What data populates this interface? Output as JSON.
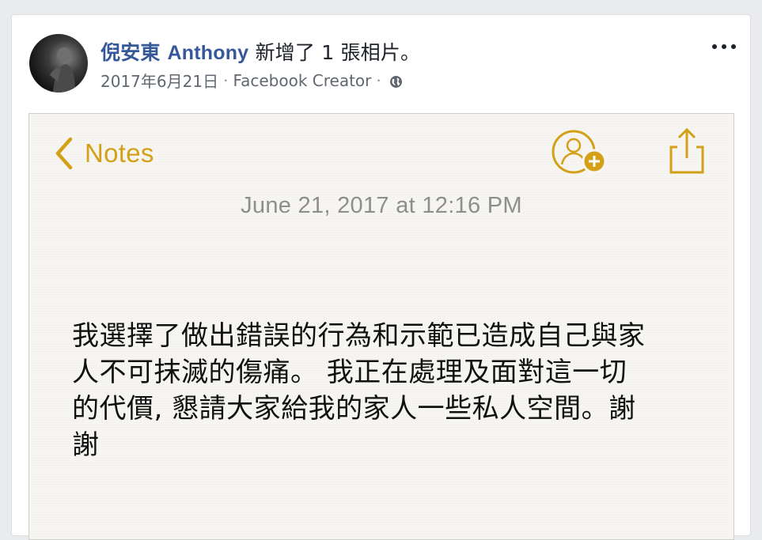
{
  "post": {
    "author_cn": "倪安東",
    "author_en": "Anthony",
    "action": "新增了 1 張相片。",
    "date": "2017年6月21日",
    "separator": "·",
    "source": "Facebook Creator",
    "privacy_icon": "globe-icon",
    "more_icon": "more-dots-icon"
  },
  "note": {
    "back_label": "Notes",
    "back_icon": "chevron-left-icon",
    "add_person_icon": "add-person-icon",
    "share_icon": "share-icon",
    "date": "June 21, 2017 at 12:16 PM",
    "body_lines": [
      "我選擇了做出錯誤的行為和示範已造成自己與家",
      "人不可抹滅的傷痛。 我正在處理及面對這一切",
      "的代價, 懇請大家給我的家人一些私人空間。謝",
      "謝"
    ]
  },
  "colors": {
    "accent_gold": "#d4a017",
    "link_blue": "#365899",
    "meta_gray": "#616770",
    "background": "#e9ebee"
  }
}
